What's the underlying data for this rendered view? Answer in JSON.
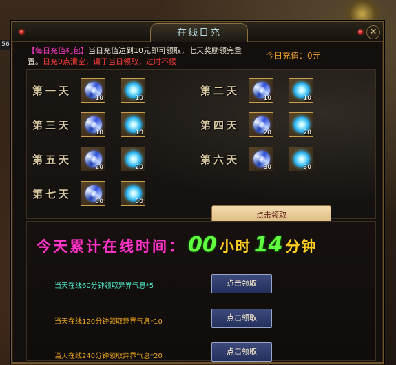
{
  "window": {
    "title": "在线日充",
    "close_glyph": "✕"
  },
  "scene": {
    "left_tag": "56"
  },
  "recharge": {
    "tag": "【每日充值礼包】",
    "desc": "当日充值达到10元即可领取，七天奖励领完重置。",
    "warn": "日充0点清空，请于当日领取，过时不候",
    "today_label": "今日充值：0元"
  },
  "days": [
    {
      "label": "第一天",
      "items": [
        {
          "icon": "swirl-orb-icon",
          "qty": "10"
        },
        {
          "icon": "glow-orb-icon",
          "qty": "10"
        }
      ]
    },
    {
      "label": "第二天",
      "items": [
        {
          "icon": "swirl-orb-icon",
          "qty": "10"
        },
        {
          "icon": "glow-orb-icon",
          "qty": "10"
        }
      ]
    },
    {
      "label": "第三天",
      "items": [
        {
          "icon": "swirl-orb-icon",
          "qty": "10"
        },
        {
          "icon": "glow-orb-icon",
          "qty": "10"
        }
      ]
    },
    {
      "label": "第四天",
      "items": [
        {
          "icon": "swirl-orb-icon",
          "qty": "20"
        },
        {
          "icon": "glow-orb-icon",
          "qty": "20"
        }
      ]
    },
    {
      "label": "第五天",
      "items": [
        {
          "icon": "swirl-orb-icon",
          "qty": "20"
        },
        {
          "icon": "glow-orb-icon",
          "qty": "20"
        }
      ]
    },
    {
      "label": "第六天",
      "items": [
        {
          "icon": "swirl-orb-icon",
          "qty": "30"
        },
        {
          "icon": "glow-orb-icon",
          "qty": "30"
        }
      ]
    },
    {
      "label": "第七天",
      "items": [
        {
          "icon": "swirl-orb-icon",
          "qty": "50"
        },
        {
          "icon": "glow-orb-icon",
          "qty": "50"
        }
      ]
    }
  ],
  "claim_recharge_label": "点击领取",
  "online": {
    "label": "今天累计在线时间：",
    "hours": "00",
    "hours_unit": "小时",
    "minutes": "14",
    "minutes_unit": "分钟",
    "tasks": [
      {
        "text": "当天在线60分钟领取异界气息*5",
        "button": "点击领取"
      },
      {
        "text": "当天在线120分钟领取异界气息*10",
        "button": "点击领取"
      },
      {
        "text": "当天在线240分钟领取异界气息*20",
        "button": "点击领取"
      }
    ]
  },
  "colors": {
    "accent_pink": "#ff36c8",
    "accent_green": "#60ff40",
    "gold": "#ffd020",
    "orange": "#f0a028"
  }
}
